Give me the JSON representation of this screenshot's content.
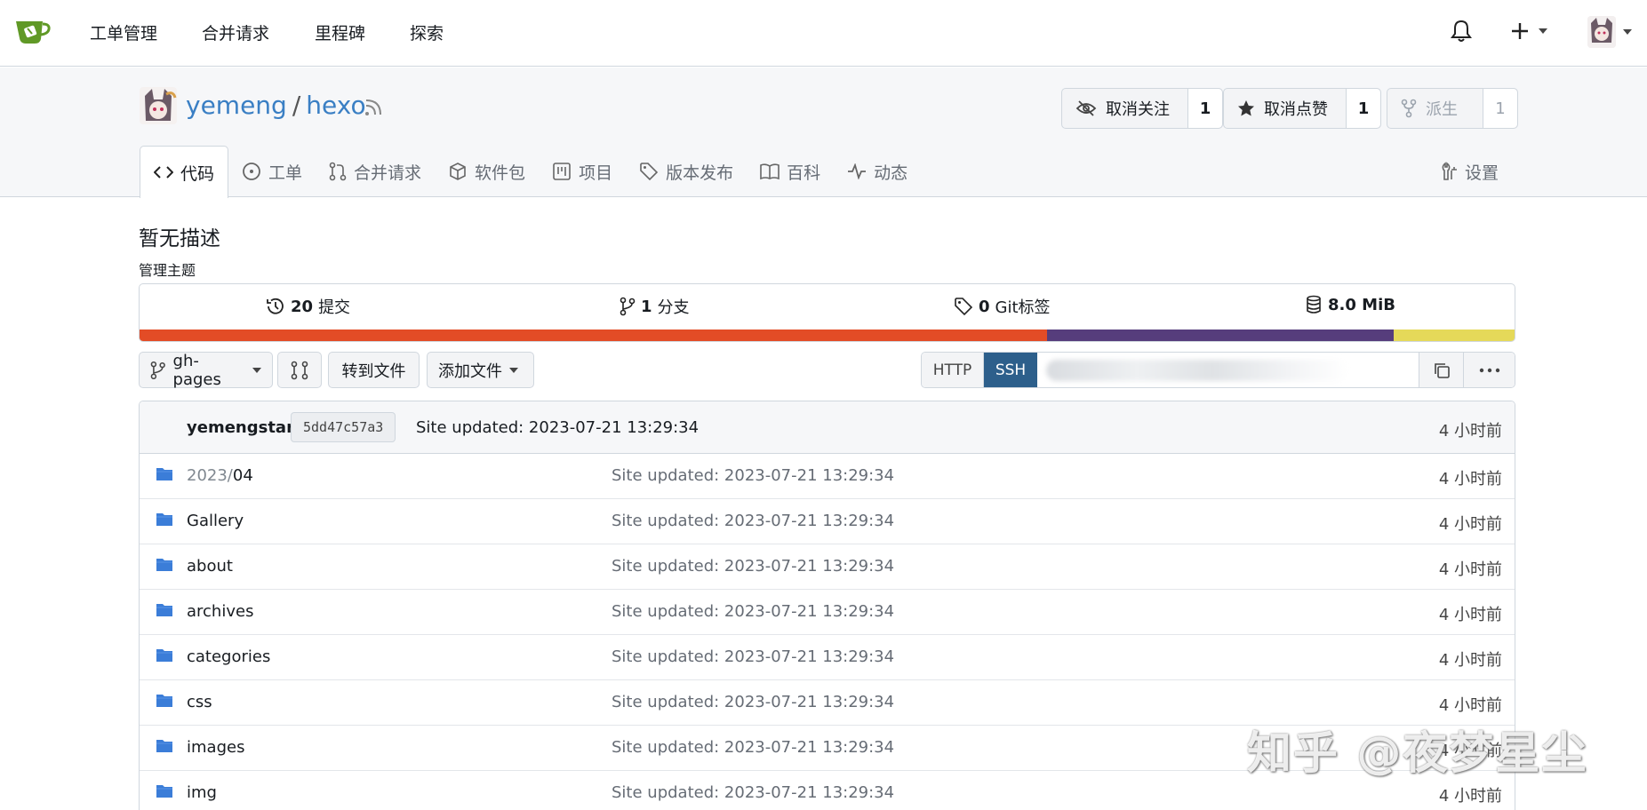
{
  "nav": {
    "items": [
      "工单管理",
      "合并请求",
      "里程碑",
      "探索"
    ],
    "plus_label": "+"
  },
  "repo": {
    "owner": "yemeng",
    "separator": "/",
    "name": "hexo",
    "watch": {
      "label": "取消关注",
      "count": "1"
    },
    "star": {
      "label": "取消点赞",
      "count": "1"
    },
    "fork": {
      "label": "派生",
      "count": "1"
    }
  },
  "tabs": [
    {
      "label": "代码",
      "icon": "code-icon"
    },
    {
      "label": "工单",
      "icon": "issue-icon"
    },
    {
      "label": "合并请求",
      "icon": "pull-request-icon"
    },
    {
      "label": "软件包",
      "icon": "package-icon"
    },
    {
      "label": "项目",
      "icon": "project-icon"
    },
    {
      "label": "版本发布",
      "icon": "tag-icon"
    },
    {
      "label": "百科",
      "icon": "book-icon"
    },
    {
      "label": "动态",
      "icon": "pulse-icon"
    }
  ],
  "settings_label": "设置",
  "description": "暂无描述",
  "manage_topics": "管理主题",
  "stats": {
    "commits": {
      "count": "20",
      "label": "提交"
    },
    "branches": {
      "count": "1",
      "label": "分支"
    },
    "tags": {
      "count": "0",
      "label": "Git标签"
    },
    "size": {
      "value": "8.0 MiB"
    }
  },
  "language_bar": [
    {
      "color": "#e34c26",
      "fraction": 0.66
    },
    {
      "color": "#563d7c",
      "fraction": 0.252
    },
    {
      "color": "#e5d959",
      "fraction": 0.088
    }
  ],
  "toolbar": {
    "branch": "gh-pages",
    "goto_file": "转到文件",
    "add_file": "添加文件",
    "http": "HTTP",
    "ssh": "SSH"
  },
  "last_commit": {
    "author": "yemengstar",
    "sha": "5dd47c57a3",
    "message": "Site updated: 2023-07-21 13:29:34",
    "time": "4 小时前"
  },
  "files": [
    {
      "prefix": "2023/",
      "name": "04",
      "message": "Site updated: 2023-07-21 13:29:34",
      "time": "4 小时前"
    },
    {
      "prefix": "",
      "name": "Gallery",
      "message": "Site updated: 2023-07-21 13:29:34",
      "time": "4 小时前"
    },
    {
      "prefix": "",
      "name": "about",
      "message": "Site updated: 2023-07-21 13:29:34",
      "time": "4 小时前"
    },
    {
      "prefix": "",
      "name": "archives",
      "message": "Site updated: 2023-07-21 13:29:34",
      "time": "4 小时前"
    },
    {
      "prefix": "",
      "name": "categories",
      "message": "Site updated: 2023-07-21 13:29:34",
      "time": "4 小时前"
    },
    {
      "prefix": "",
      "name": "css",
      "message": "Site updated: 2023-07-21 13:29:34",
      "time": "4 小时前"
    },
    {
      "prefix": "",
      "name": "images",
      "message": "Site updated: 2023-07-21 13:29:34",
      "time": "4 小时前"
    },
    {
      "prefix": "",
      "name": "img",
      "message": "Site updated: 2023-07-21 13:29:34",
      "time": "4 小时前"
    }
  ],
  "watermark": "知乎 @夜梦星尘"
}
